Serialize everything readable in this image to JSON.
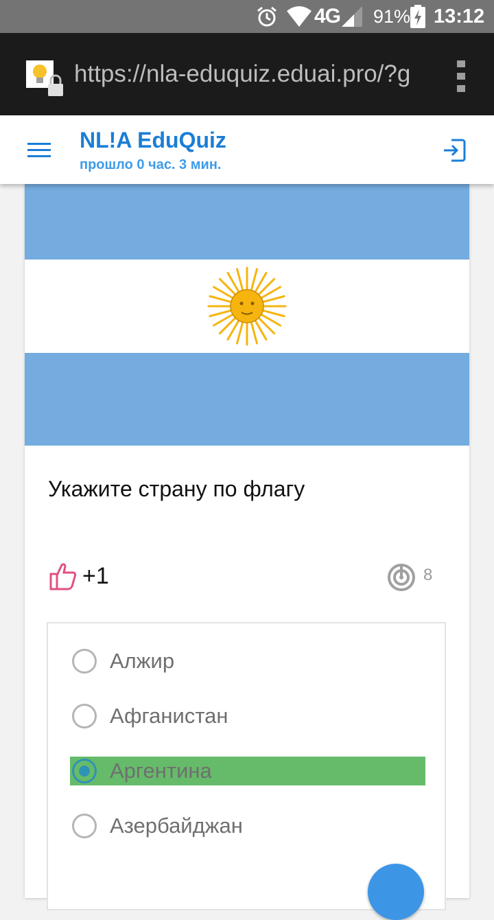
{
  "status_bar": {
    "network": "4G",
    "battery": "91%",
    "time": "13:12",
    "icons": [
      "alarm-icon",
      "wifi-icon",
      "signal-icon",
      "battery-charging-icon"
    ]
  },
  "browser": {
    "url": "https://nla-eduquiz.eduai.pro/?g",
    "icons": [
      "lightbulb-lock-icon",
      "overflow-menu-icon"
    ]
  },
  "header": {
    "title": "NL!A EduQuiz",
    "subtitle": "прошло 0 час. 3 мин.",
    "icons": [
      "hamburger-menu-icon",
      "logout-icon"
    ]
  },
  "quiz": {
    "question": "Укажите страну по флагу",
    "likes": "+1",
    "attempts": "8",
    "colors": {
      "flag_blue": "#74acdf",
      "flag_sun": "#f6b40e",
      "selected": "#66bb6a",
      "accent": "#1a7ed6"
    },
    "answers": [
      {
        "label": "Алжир",
        "selected": false
      },
      {
        "label": "Афганистан",
        "selected": false
      },
      {
        "label": "Аргентина",
        "selected": true
      },
      {
        "label": "Азербайджан",
        "selected": false
      }
    ]
  }
}
